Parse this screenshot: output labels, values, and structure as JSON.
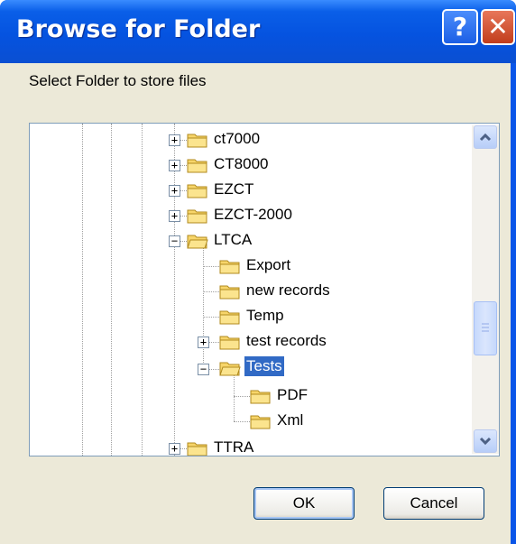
{
  "window": {
    "title": "Browse for Folder"
  },
  "titlebar": {
    "help_label": "?",
    "close_label": "✕"
  },
  "prompt": "Select Folder to store files",
  "tree": {
    "nodes": [
      {
        "label": "ct7000",
        "expander": "+"
      },
      {
        "label": "CT8000",
        "expander": "+"
      },
      {
        "label": "EZCT",
        "expander": "+"
      },
      {
        "label": "EZCT-2000",
        "expander": "+"
      },
      {
        "label": "LTCA",
        "expander": "−"
      },
      {
        "label": "Export"
      },
      {
        "label": "new records"
      },
      {
        "label": "Temp"
      },
      {
        "label": "test records",
        "expander": "+"
      },
      {
        "label": "Tests",
        "expander": "−",
        "selected": true
      },
      {
        "label": "PDF"
      },
      {
        "label": "Xml"
      },
      {
        "label": "TTRA",
        "expander": "+"
      }
    ]
  },
  "buttons": {
    "ok": "OK",
    "cancel": "Cancel"
  }
}
